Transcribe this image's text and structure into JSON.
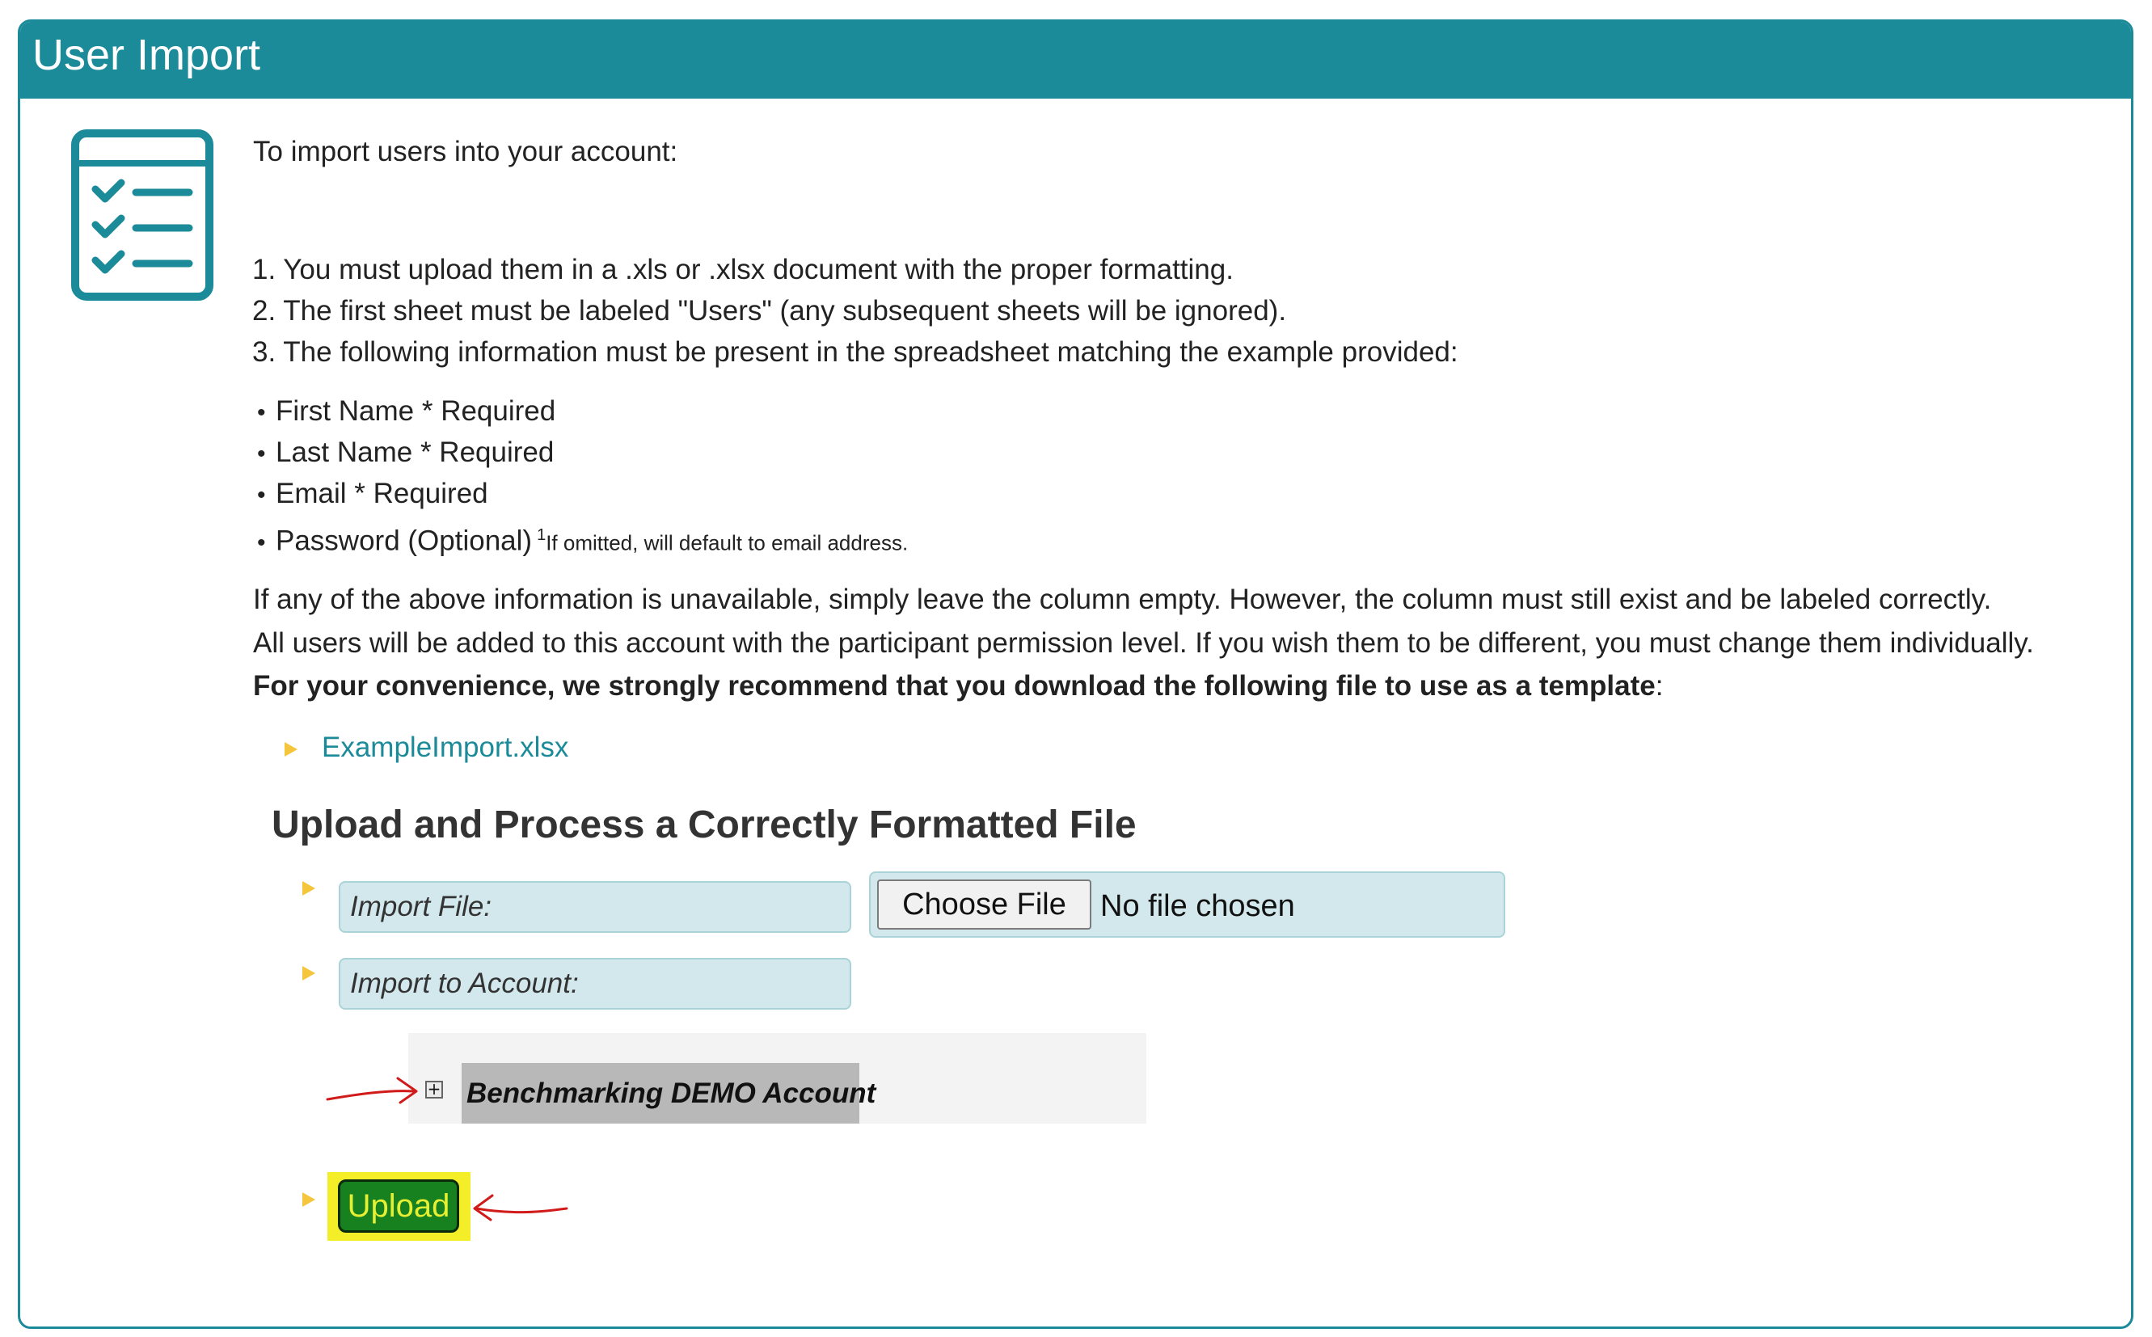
{
  "header": {
    "title": "User Import"
  },
  "intro": "To import users into your account:",
  "steps": [
    "1. You must upload them in a .xls or .xlsx document with the proper formatting.",
    "2. The first sheet must be labeled \"Users\" (any subsequent sheets will be ignored).",
    "3. The following information must be present in the spreadsheet matching the example provided:"
  ],
  "fields": [
    "First Name * Required",
    "Last Name * Required",
    "Email * Required",
    "Password (Optional)"
  ],
  "password_note": {
    "sup": "1",
    "text": "If omitted, will default to email address."
  },
  "notes": {
    "unavailable": "If any of the above information is unavailable, simply leave the column empty. However, the column must still exist and be labeled correctly.",
    "permission": "All users will be added to this account with the participant permission level. If you wish them to be different, you must change them individually.",
    "recommend_bold": "For your convenience, we strongly recommend that you download the following file to use as a template",
    "recommend_tail": ":"
  },
  "template_link": "ExampleImport.xlsx",
  "upload_section": {
    "heading": "Upload and Process a Correctly Formatted File",
    "import_file_label": "Import File:",
    "choose_file_button": "Choose File",
    "no_file_text": "No file chosen",
    "import_account_label": "Import to Account:",
    "tree_expand_symbol": "+",
    "account_name": "Benchmarking DEMO Account",
    "upload_button": "Upload"
  },
  "colors": {
    "header": "#1b8a99",
    "field_bg": "#d2e8ec",
    "bullet_triangle": "#f5c63c",
    "upload_bg": "#18811f",
    "highlight": "#f3ee27",
    "annotation": "#d11a1a"
  },
  "icons": {
    "checklist": "checklist-icon",
    "tree_expand": "plus-box-icon",
    "arrow": "red-arrow-annotation"
  }
}
